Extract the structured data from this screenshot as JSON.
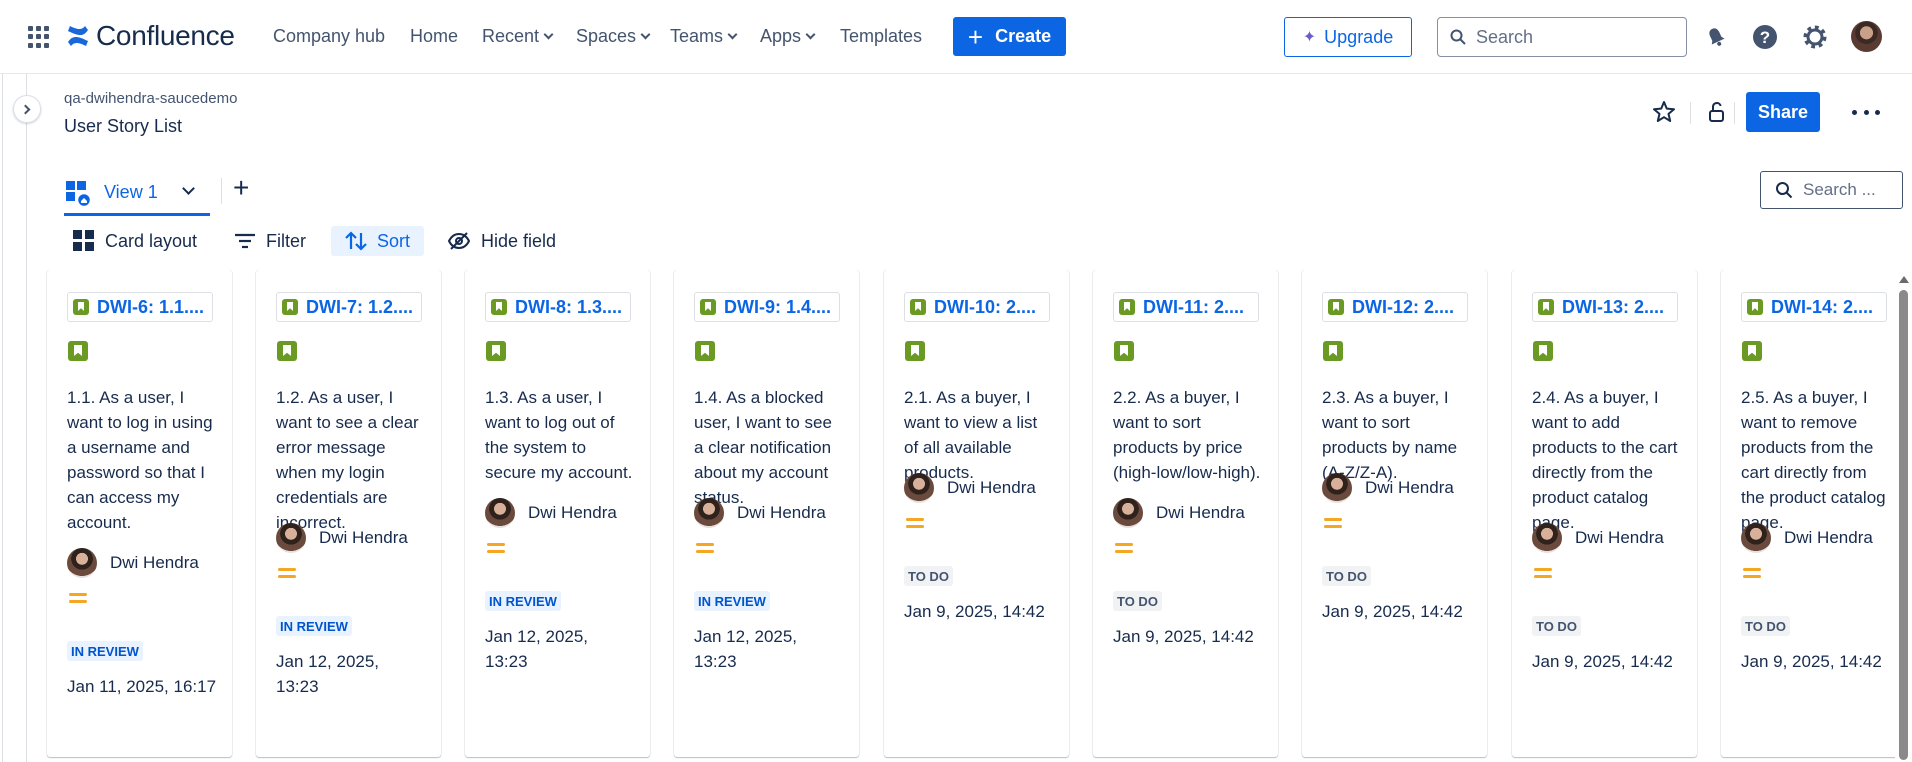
{
  "app": {
    "name": "Confluence",
    "nav": {
      "company_hub": "Company hub",
      "home": "Home",
      "recent": "Recent",
      "spaces": "Spaces",
      "teams": "Teams",
      "apps": "Apps",
      "templates": "Templates"
    },
    "create_label": "Create",
    "upgrade_label": "Upgrade",
    "search_placeholder": "Search",
    "accent_color": "#0c66e4"
  },
  "page": {
    "space": "qa-dwihendra-saucedemo",
    "title": "User Story List",
    "share_label": "Share"
  },
  "views": {
    "active_tab": "View 1",
    "search_placeholder": "Search ..."
  },
  "toolbar": {
    "card_layout": "Card layout",
    "filter": "Filter",
    "sort": "Sort",
    "hide_field": "Hide field"
  },
  "cards": [
    {
      "key": "DWI-6: 1.1....",
      "summary": "1.1. As a user, I want to log in using a username and password so that I can access my account.",
      "assignee": "Dwi Hendra",
      "status": "IN REVIEW",
      "date": "Jan 11, 2025, 16:17"
    },
    {
      "key": "DWI-7: 1.2....",
      "summary": "1.2. As a user, I want to see a clear error message when my login credentials are incorrect.",
      "assignee": "Dwi Hendra",
      "status": "IN REVIEW",
      "date": "Jan 12, 2025, 13:23"
    },
    {
      "key": "DWI-8: 1.3....",
      "summary": "1.3. As a user, I want to log out of the system to secure my account.",
      "assignee": "Dwi Hendra",
      "status": "IN REVIEW",
      "date": "Jan 12, 2025, 13:23"
    },
    {
      "key": "DWI-9: 1.4....",
      "summary": "1.4. As a blocked user, I want to see a clear notification about my account status.",
      "assignee": "Dwi Hendra",
      "status": "IN REVIEW",
      "date": "Jan 12, 2025, 13:23"
    },
    {
      "key": "DWI-10: 2....",
      "summary": "2.1. As a buyer, I want to view a list of all available products.",
      "assignee": "Dwi Hendra",
      "status": "TO DO",
      "date": "Jan 9, 2025, 14:42"
    },
    {
      "key": "DWI-11: 2....",
      "summary": "2.2. As a buyer, I want to sort products by price (high-low/low-high).",
      "assignee": "Dwi Hendra",
      "status": "TO DO",
      "date": "Jan 9, 2025, 14:42"
    },
    {
      "key": "DWI-12: 2....",
      "summary": "2.3. As a buyer, I want to sort products by name (A-Z/Z-A).",
      "assignee": "Dwi Hendra",
      "status": "TO DO",
      "date": "Jan 9, 2025, 14:42"
    },
    {
      "key": "DWI-13: 2....",
      "summary": "2.4. As a buyer, I want to add products to the cart directly from the product catalog page.",
      "assignee": "Dwi Hendra",
      "status": "TO DO",
      "date": "Jan 9, 2025, 14:42"
    },
    {
      "key": "DWI-14: 2....",
      "summary": "2.5. As a buyer, I want to remove products from the cart directly from the product catalog page.",
      "assignee": "Dwi Hendra",
      "status": "TO DO",
      "date": "Jan 9, 2025, 14:42"
    }
  ]
}
